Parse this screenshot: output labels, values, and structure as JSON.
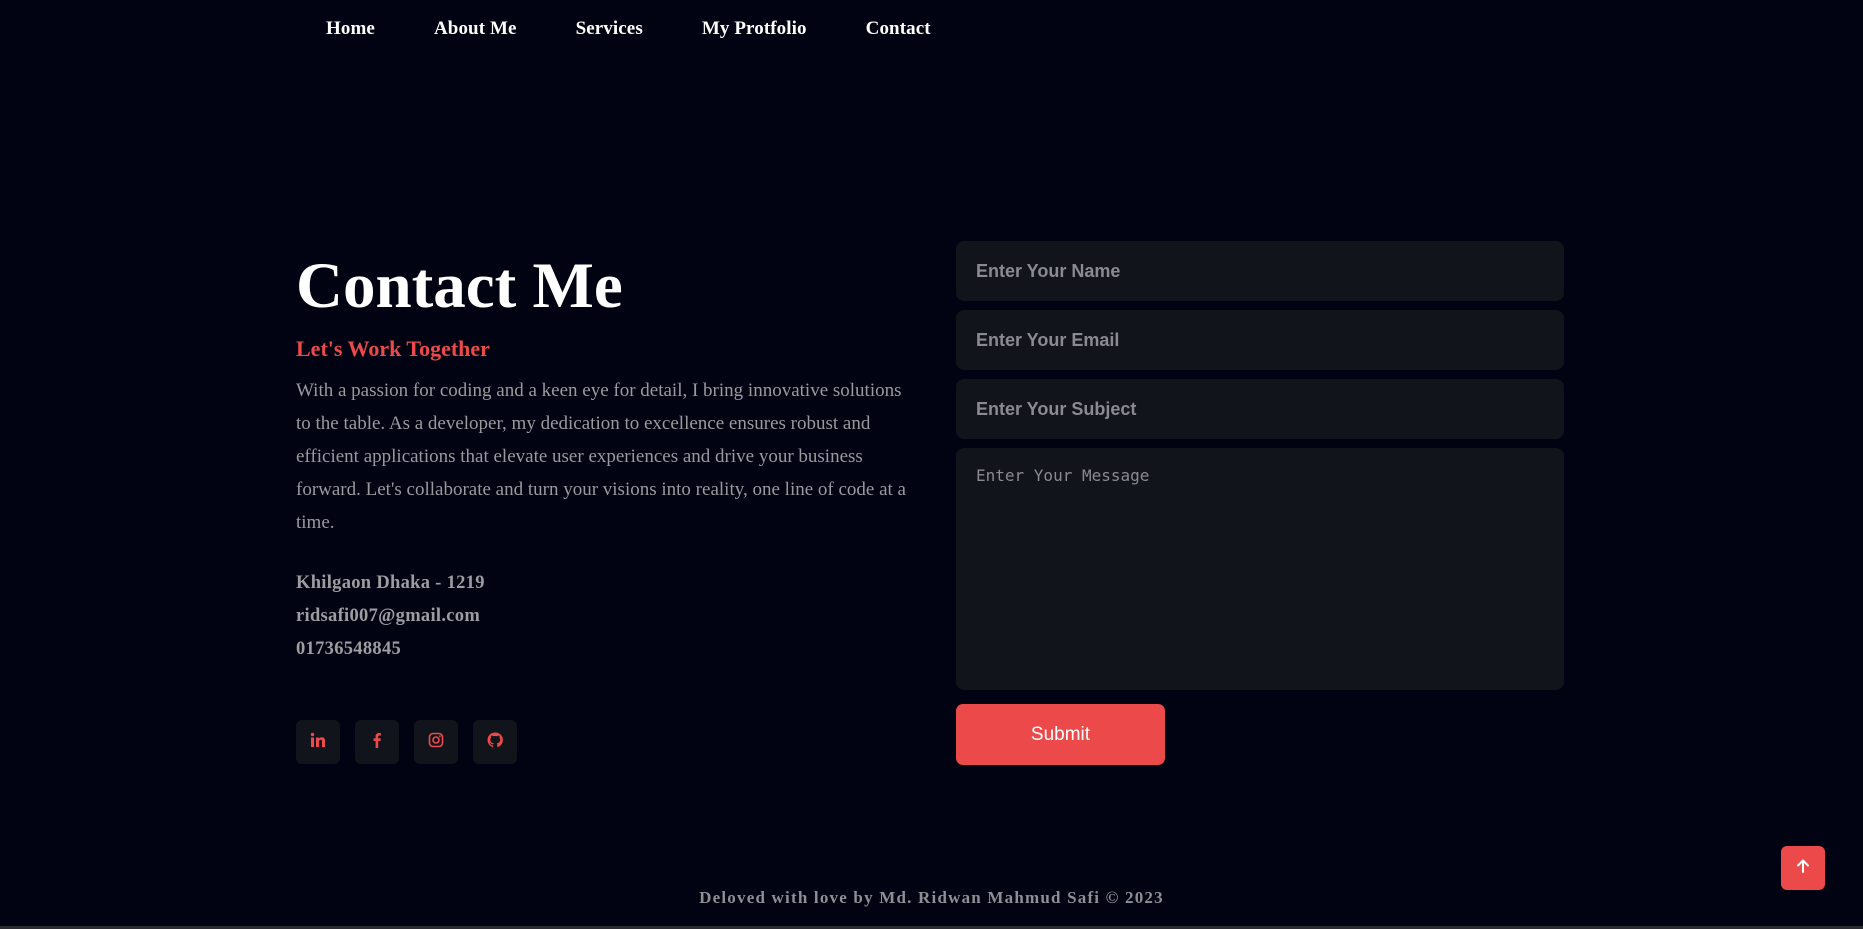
{
  "nav": {
    "items": [
      {
        "label": "Home"
      },
      {
        "label": "About Me"
      },
      {
        "label": "Services"
      },
      {
        "label": "My Protfolio"
      },
      {
        "label": "Contact"
      }
    ]
  },
  "contact": {
    "title": "Contact Me",
    "subtitle": "Let's Work Together",
    "description": "With a passion for coding and a keen eye for detail, I bring innovative solutions to the table. As a developer, my dedication to excellence ensures robust and efficient applications that elevate user experiences and drive your business forward. Let's collaborate and turn your visions into reality, one line of code at a time.",
    "address": "Khilgaon Dhaka - 1219",
    "email": "ridsafi007@gmail.com",
    "phone": "01736548845"
  },
  "socials": [
    {
      "icon": "linkedin-icon"
    },
    {
      "icon": "facebook-icon"
    },
    {
      "icon": "instagram-icon"
    },
    {
      "icon": "github-icon"
    }
  ],
  "form": {
    "name_placeholder": "Enter Your Name",
    "email_placeholder": "Enter Your Email",
    "subject_placeholder": "Enter Your Subject",
    "message_placeholder": "Enter Your Message",
    "submit_label": "Submit"
  },
  "footer": {
    "text": "Deloved with love by Md. Ridwan Mahmud Safi © 2023"
  },
  "colors": {
    "background": "#020312",
    "accent": "#ec4a4a",
    "field_bg": "#12141b"
  },
  "scroll_top": {
    "icon": "arrow-up-icon"
  }
}
